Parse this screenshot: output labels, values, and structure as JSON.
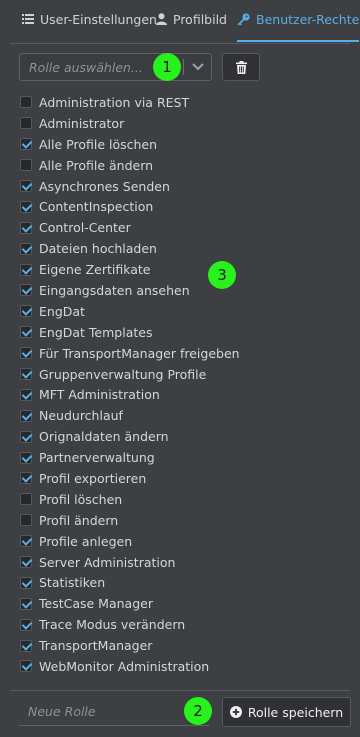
{
  "tabs": [
    {
      "label": "User-Einstellungen",
      "icon": "list-icon",
      "active": false
    },
    {
      "label": "Profilbild",
      "icon": "user-icon",
      "active": false
    },
    {
      "label": "Benutzer-Rechte",
      "icon": "key-icon",
      "active": true
    }
  ],
  "role_select": {
    "placeholder": "Rolle auswählen..."
  },
  "markers": [
    "1",
    "2",
    "3"
  ],
  "permissions": [
    {
      "label": "Administration via REST",
      "checked": false
    },
    {
      "label": "Administrator",
      "checked": false
    },
    {
      "label": "Alle Profile löschen",
      "checked": true
    },
    {
      "label": "Alle Profile ändern",
      "checked": false
    },
    {
      "label": "Asynchrones Senden",
      "checked": true
    },
    {
      "label": "ContentInspection",
      "checked": true
    },
    {
      "label": "Control-Center",
      "checked": true
    },
    {
      "label": "Dateien hochladen",
      "checked": true
    },
    {
      "label": "Eigene Zertifikate",
      "checked": true
    },
    {
      "label": "Eingangsdaten ansehen",
      "checked": true
    },
    {
      "label": "EngDat",
      "checked": true
    },
    {
      "label": "EngDat Templates",
      "checked": true
    },
    {
      "label": "Für TransportManager freigeben",
      "checked": true
    },
    {
      "label": "Gruppenverwaltung Profile",
      "checked": true
    },
    {
      "label": "MFT Administration",
      "checked": true
    },
    {
      "label": "Neudurchlauf",
      "checked": true
    },
    {
      "label": "Orignaldaten ändern",
      "checked": true
    },
    {
      "label": "Partnerverwaltung",
      "checked": true
    },
    {
      "label": "Profil exportieren",
      "checked": true
    },
    {
      "label": "Profil löschen",
      "checked": false
    },
    {
      "label": "Profil ändern",
      "checked": false
    },
    {
      "label": "Profile anlegen",
      "checked": true
    },
    {
      "label": "Server Administration",
      "checked": true
    },
    {
      "label": "Statistiken",
      "checked": true
    },
    {
      "label": "TestCase Manager",
      "checked": true
    },
    {
      "label": "Trace Modus verändern",
      "checked": true
    },
    {
      "label": "TransportManager",
      "checked": true
    },
    {
      "label": "WebMonitor Administration",
      "checked": true
    }
  ],
  "new_role": {
    "placeholder": "Neue Rolle"
  },
  "save_button": {
    "label": "Rolle speichern",
    "icon": "plus-circle-icon"
  },
  "colors": {
    "accent": "#5aaee6",
    "marker": "#27f21c",
    "background": "#3d3f42"
  }
}
